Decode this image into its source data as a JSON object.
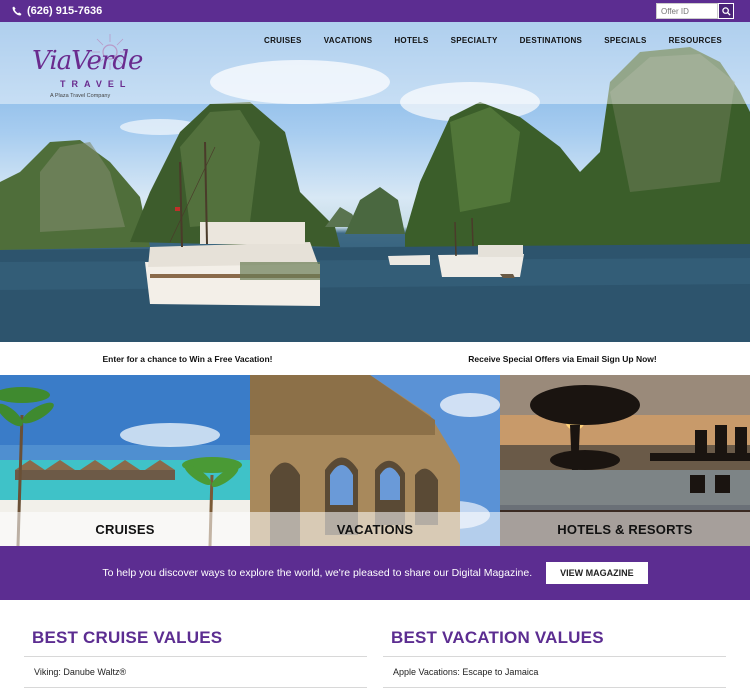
{
  "topbar": {
    "phone": "(626) 915-7636",
    "offer_placeholder": "Offer ID"
  },
  "logo": {
    "script": "ViaVerde",
    "travel": "TRAVEL",
    "sub": "A Plaza Travel Company"
  },
  "nav": {
    "items": [
      "CRUISES",
      "VACATIONS",
      "HOTELS",
      "SPECIALTY",
      "DESTINATIONS",
      "SPECIALS",
      "RESOURCES"
    ]
  },
  "promo": {
    "left": "Enter for a chance to Win a Free Vacation!",
    "right": "Receive Special Offers via Email Sign Up Now!"
  },
  "tiles": [
    {
      "label": "CRUISES"
    },
    {
      "label": "VACATIONS"
    },
    {
      "label": "HOTELS & RESORTS"
    }
  ],
  "magazine": {
    "text": "To help you discover ways to explore the world, we're pleased to share our Digital Magazine.",
    "button": "VIEW MAGAZINE"
  },
  "values": {
    "cruise_title": "BEST CRUISE VALUES",
    "cruise_first": "Viking: Danube Waltz®",
    "vacation_title": "BEST VACATION VALUES",
    "vacation_first": "Apple Vacations: Escape to Jamaica"
  },
  "colors": {
    "brand_purple": "#5c2d91"
  }
}
